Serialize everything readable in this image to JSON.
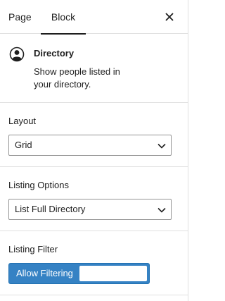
{
  "tabs": [
    {
      "label": "Page"
    },
    {
      "label": "Block"
    }
  ],
  "header": {
    "close_icon": "close-icon"
  },
  "block_card": {
    "icon": "user-circle-icon",
    "title": "Directory",
    "description": "Show people listed in your directory."
  },
  "layout": {
    "label": "Layout",
    "selected": "Grid"
  },
  "listing_options": {
    "label": "Listing Options",
    "selected": "List Full Directory"
  },
  "listing_filter": {
    "label": "Listing Filter",
    "toggle_label": "Allow Filtering"
  },
  "colors": {
    "accent": "#3582c4",
    "text": "#1e1e1e",
    "border": "#e0e0e0"
  }
}
